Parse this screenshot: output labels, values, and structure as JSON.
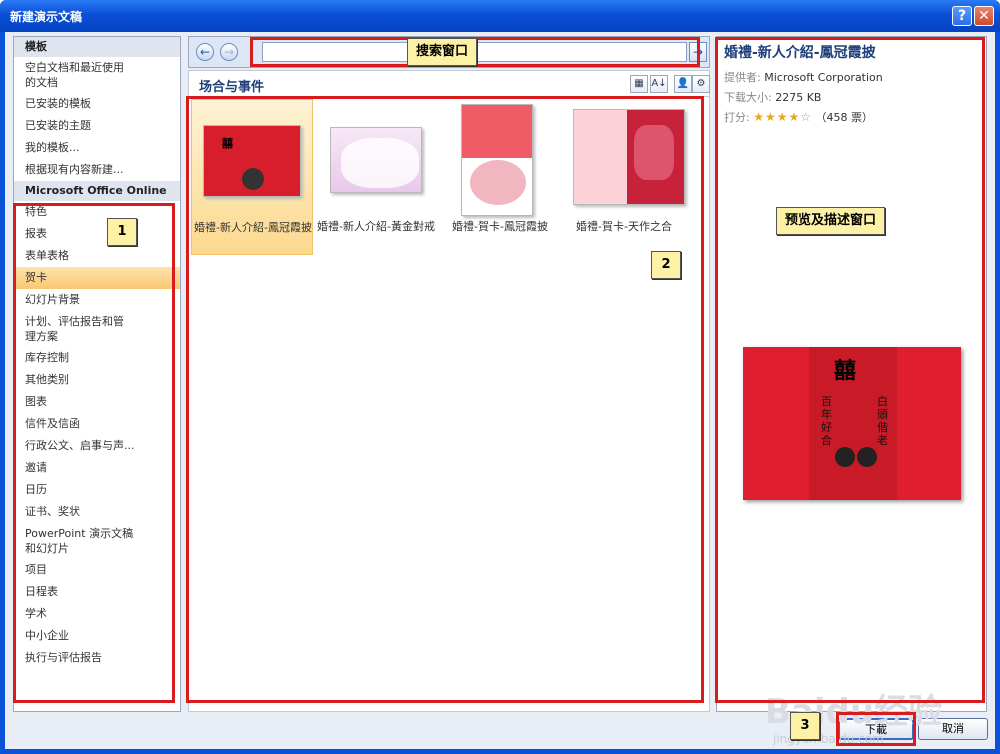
{
  "window": {
    "title": "新建演示文稿",
    "help": "?",
    "close": "✕"
  },
  "left": {
    "section1": "模板",
    "items1": [
      "空白文档和最近使用\n的文档",
      "已安装的模板",
      "已安装的主题",
      "我的模板...",
      "根据现有内容新建..."
    ],
    "section2": "Microsoft Office Online",
    "items2": [
      "特色",
      "报表",
      "表单表格",
      "贺卡",
      "幻灯片背景",
      "计划、评估报告和管\n理方案",
      "库存控制",
      "其他类别",
      "图表",
      "信件及信函",
      "行政公文、启事与声...",
      "邀请",
      "日历",
      "证书、奖状",
      "PowerPoint 演示文稿\n和幻灯片",
      "项目",
      "日程表",
      "学术",
      "中小企业",
      "执行与评估报告"
    ],
    "selected_item": "贺卡"
  },
  "search": {
    "back": "←",
    "forward": "→",
    "go": "→",
    "value": ""
  },
  "category": {
    "title": "场合与事件",
    "view_icons": [
      "▦",
      "A↓",
      "👤",
      "⚙"
    ]
  },
  "tiles": [
    {
      "label": "婚禮-新人介紹-鳳冠霞披",
      "thumb_text": "囍",
      "selected": true
    },
    {
      "label": "婚禮-新人介紹-黃金對戒",
      "thumb_text": "",
      "selected": false
    },
    {
      "label": "婚禮-賀卡-鳳冠霞披",
      "thumb_text": "",
      "selected": false
    },
    {
      "label": "婚禮-賀卡-天作之合",
      "thumb_text": "",
      "selected": false
    }
  ],
  "preview": {
    "title": "婚禮-新人介紹-鳳冠霞披",
    "provider_label": "提供者:",
    "provider": "Microsoft Corporation",
    "size_label": "下载大小:",
    "size": "2275 KB",
    "rating_label": "打分:",
    "rating_stars": 4,
    "votes": "（458 票）",
    "image_text": "囍",
    "image_left": "百年好合",
    "image_right": "白頭偕老"
  },
  "buttons": {
    "download": "下載",
    "cancel": "取消"
  },
  "annotations": {
    "search_label": "搜索窗口",
    "label1": "1",
    "label2": "2",
    "label3": "3",
    "preview_label": "预览及描述窗口"
  },
  "watermark": {
    "text": "Baidu经验",
    "sub": "jingyan.baidu.com"
  },
  "colors": {
    "titlebar": "#0a4fd6",
    "accent": "#1e3f7a",
    "annotation": "#d81b1b",
    "selected": "#fbc671"
  }
}
